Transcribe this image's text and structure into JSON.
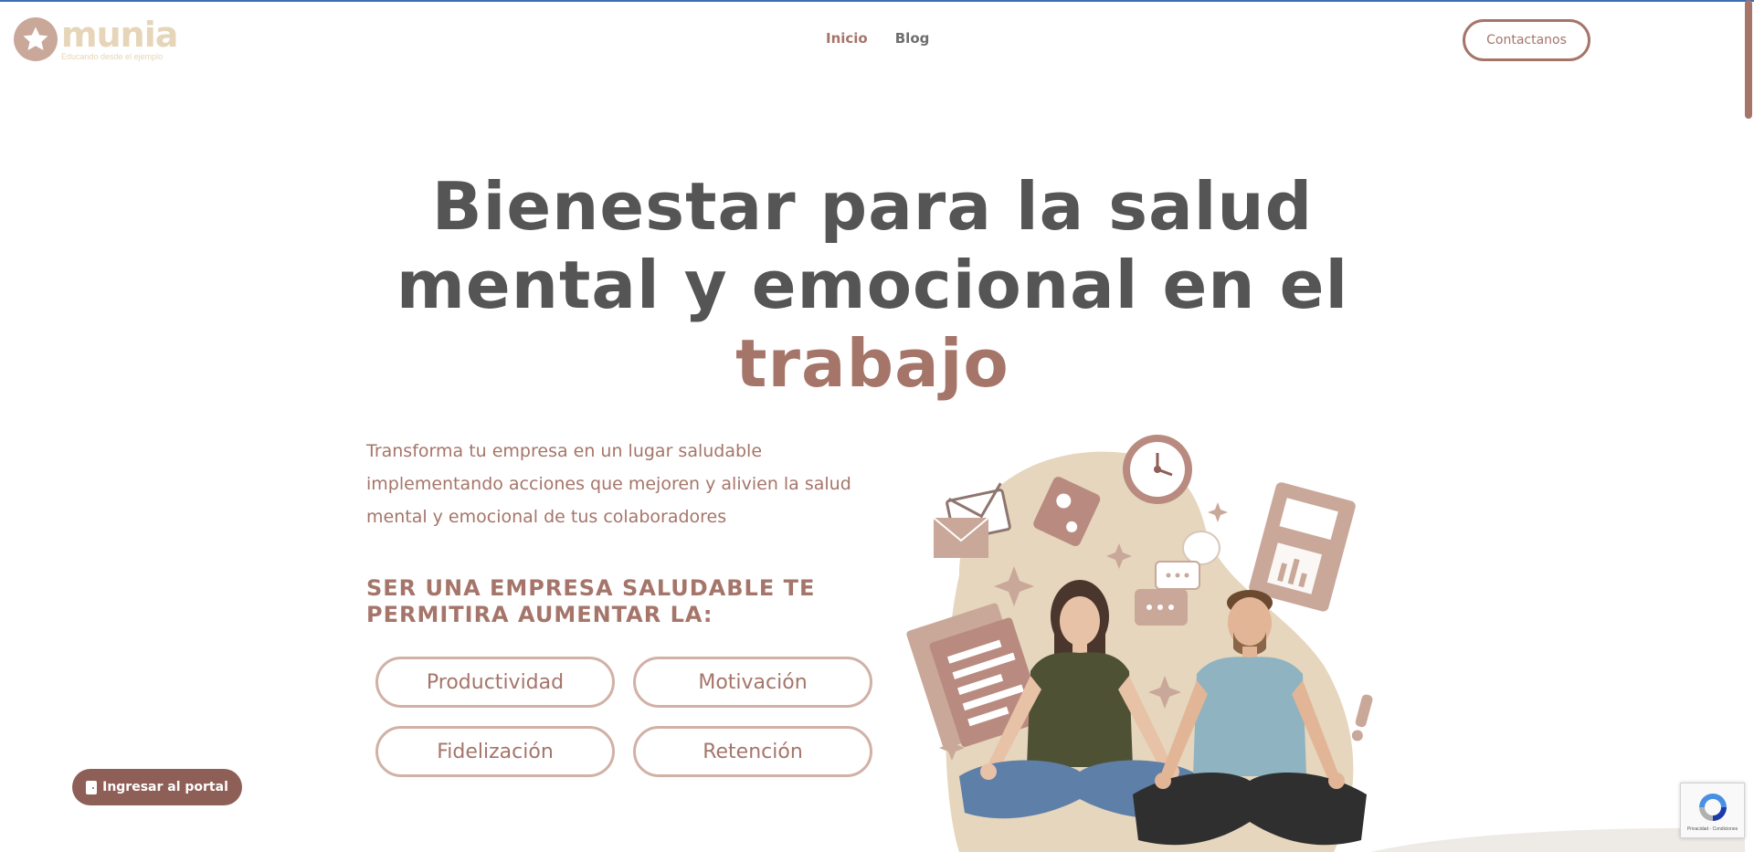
{
  "header": {
    "logo_word": "munia",
    "logo_tagline": "Educando desde el ejemplo",
    "nav": [
      {
        "label": "Inicio",
        "active": true
      },
      {
        "label": "Blog",
        "active": false
      }
    ],
    "contact_label": "Contactanos"
  },
  "hero": {
    "title_line1": "Bienestar para la salud",
    "title_line2": "mental y emocional en el",
    "title_accent": "trabajo",
    "lead": "Transforma tu empresa en un lugar saludable implementando acciones que mejoren y alivien la salud mental y emocional de tus colaboradores",
    "subhead": "SER UNA EMPRESA SALUDABLE TE PERMITIRA AUMENTAR LA:",
    "pills": [
      "Productividad",
      "Motivación",
      "Fidelización",
      "Retención"
    ]
  },
  "portal_button": "Ingresar al portal",
  "recaptcha_text": "Privacidad - Condiciones",
  "colors": {
    "brand": "#a5756a",
    "brand_dark": "#8e5f56",
    "title_gray": "#555555",
    "logo_cream": "#e6d5b8",
    "pill_border": "#d1b1a6",
    "blob_beige": "#e5d6bd"
  },
  "icons": [
    "star-icon",
    "door-icon",
    "recaptcha-icon",
    "clock-icon",
    "envelope-icon",
    "chat-bubble-icon",
    "document-icon",
    "calculator-icon",
    "sparkle-icon",
    "exclamation-icon"
  ]
}
